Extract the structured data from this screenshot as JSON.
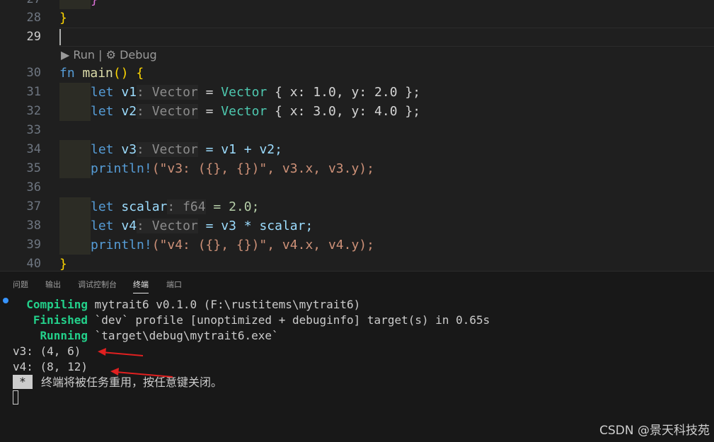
{
  "editor": {
    "line_numbers": {
      "l27": "27",
      "l28": "28",
      "l29": "29",
      "l30": "30",
      "l31": "31",
      "l32": "32",
      "l33": "33",
      "l34": "34",
      "l35": "35",
      "l36": "36",
      "l37": "37",
      "l38": "38",
      "l39": "39",
      "l40": "40"
    },
    "codelens": {
      "run": "▶ Run",
      "sep": " | ",
      "debug": "⚙ Debug"
    },
    "lines": {
      "l27": "}",
      "l28": "}",
      "l30": {
        "kw": "fn",
        "name": "main",
        "rest": "() {"
      },
      "l31": {
        "kw": "let",
        "var": "v1",
        "hint": ": Vector",
        "eq": " = ",
        "ty": "Vector",
        "body": " { x: 1.0, y: 2.0 };"
      },
      "l32": {
        "kw": "let",
        "var": "v2",
        "hint": ": Vector",
        "eq": " = ",
        "ty": "Vector",
        "body": " { x: 3.0, y: 4.0 };"
      },
      "l34": {
        "kw": "let",
        "var": "v3",
        "hint": ": Vector",
        "rest": " = v1 + v2;"
      },
      "l35": {
        "mac": "println!",
        "rest": "(\"v3: ({}, {})\", v3.x, v3.y);"
      },
      "l37": {
        "kw": "let",
        "var": "scalar",
        "hint": ": f64",
        "rest": " = 2.0;"
      },
      "l38": {
        "kw": "let",
        "var": "v4",
        "hint": ": Vector",
        "rest": " = v3 * scalar;"
      },
      "l39": {
        "mac": "println!",
        "rest": "(\"v4: ({}, {})\", v4.x, v4.y);"
      },
      "l40": "}"
    }
  },
  "panel": {
    "tabs": [
      "问题",
      "输出",
      "调试控制台",
      "终端",
      "端口"
    ],
    "active_tab": "终端",
    "terminal": {
      "compiling_label": "Compiling",
      "compiling_text": " mytrait6 v0.1.0 (F:\\rustitems\\mytrait6)",
      "finished_label": "Finished",
      "finished_text": " `dev` profile [unoptimized + debuginfo] target(s) in 0.65s",
      "running_label": "Running",
      "running_text": " `target\\debug\\mytrait6.exe`",
      "out1": "v3: (4, 6)",
      "out2": "v4: (8, 12)",
      "badge": "*",
      "message": "终端将被任务重用，按任意键关闭。"
    }
  },
  "watermark": "CSDN @景天科技苑",
  "colors": {
    "arrow": "#e02020",
    "accent": "#3794ff"
  }
}
